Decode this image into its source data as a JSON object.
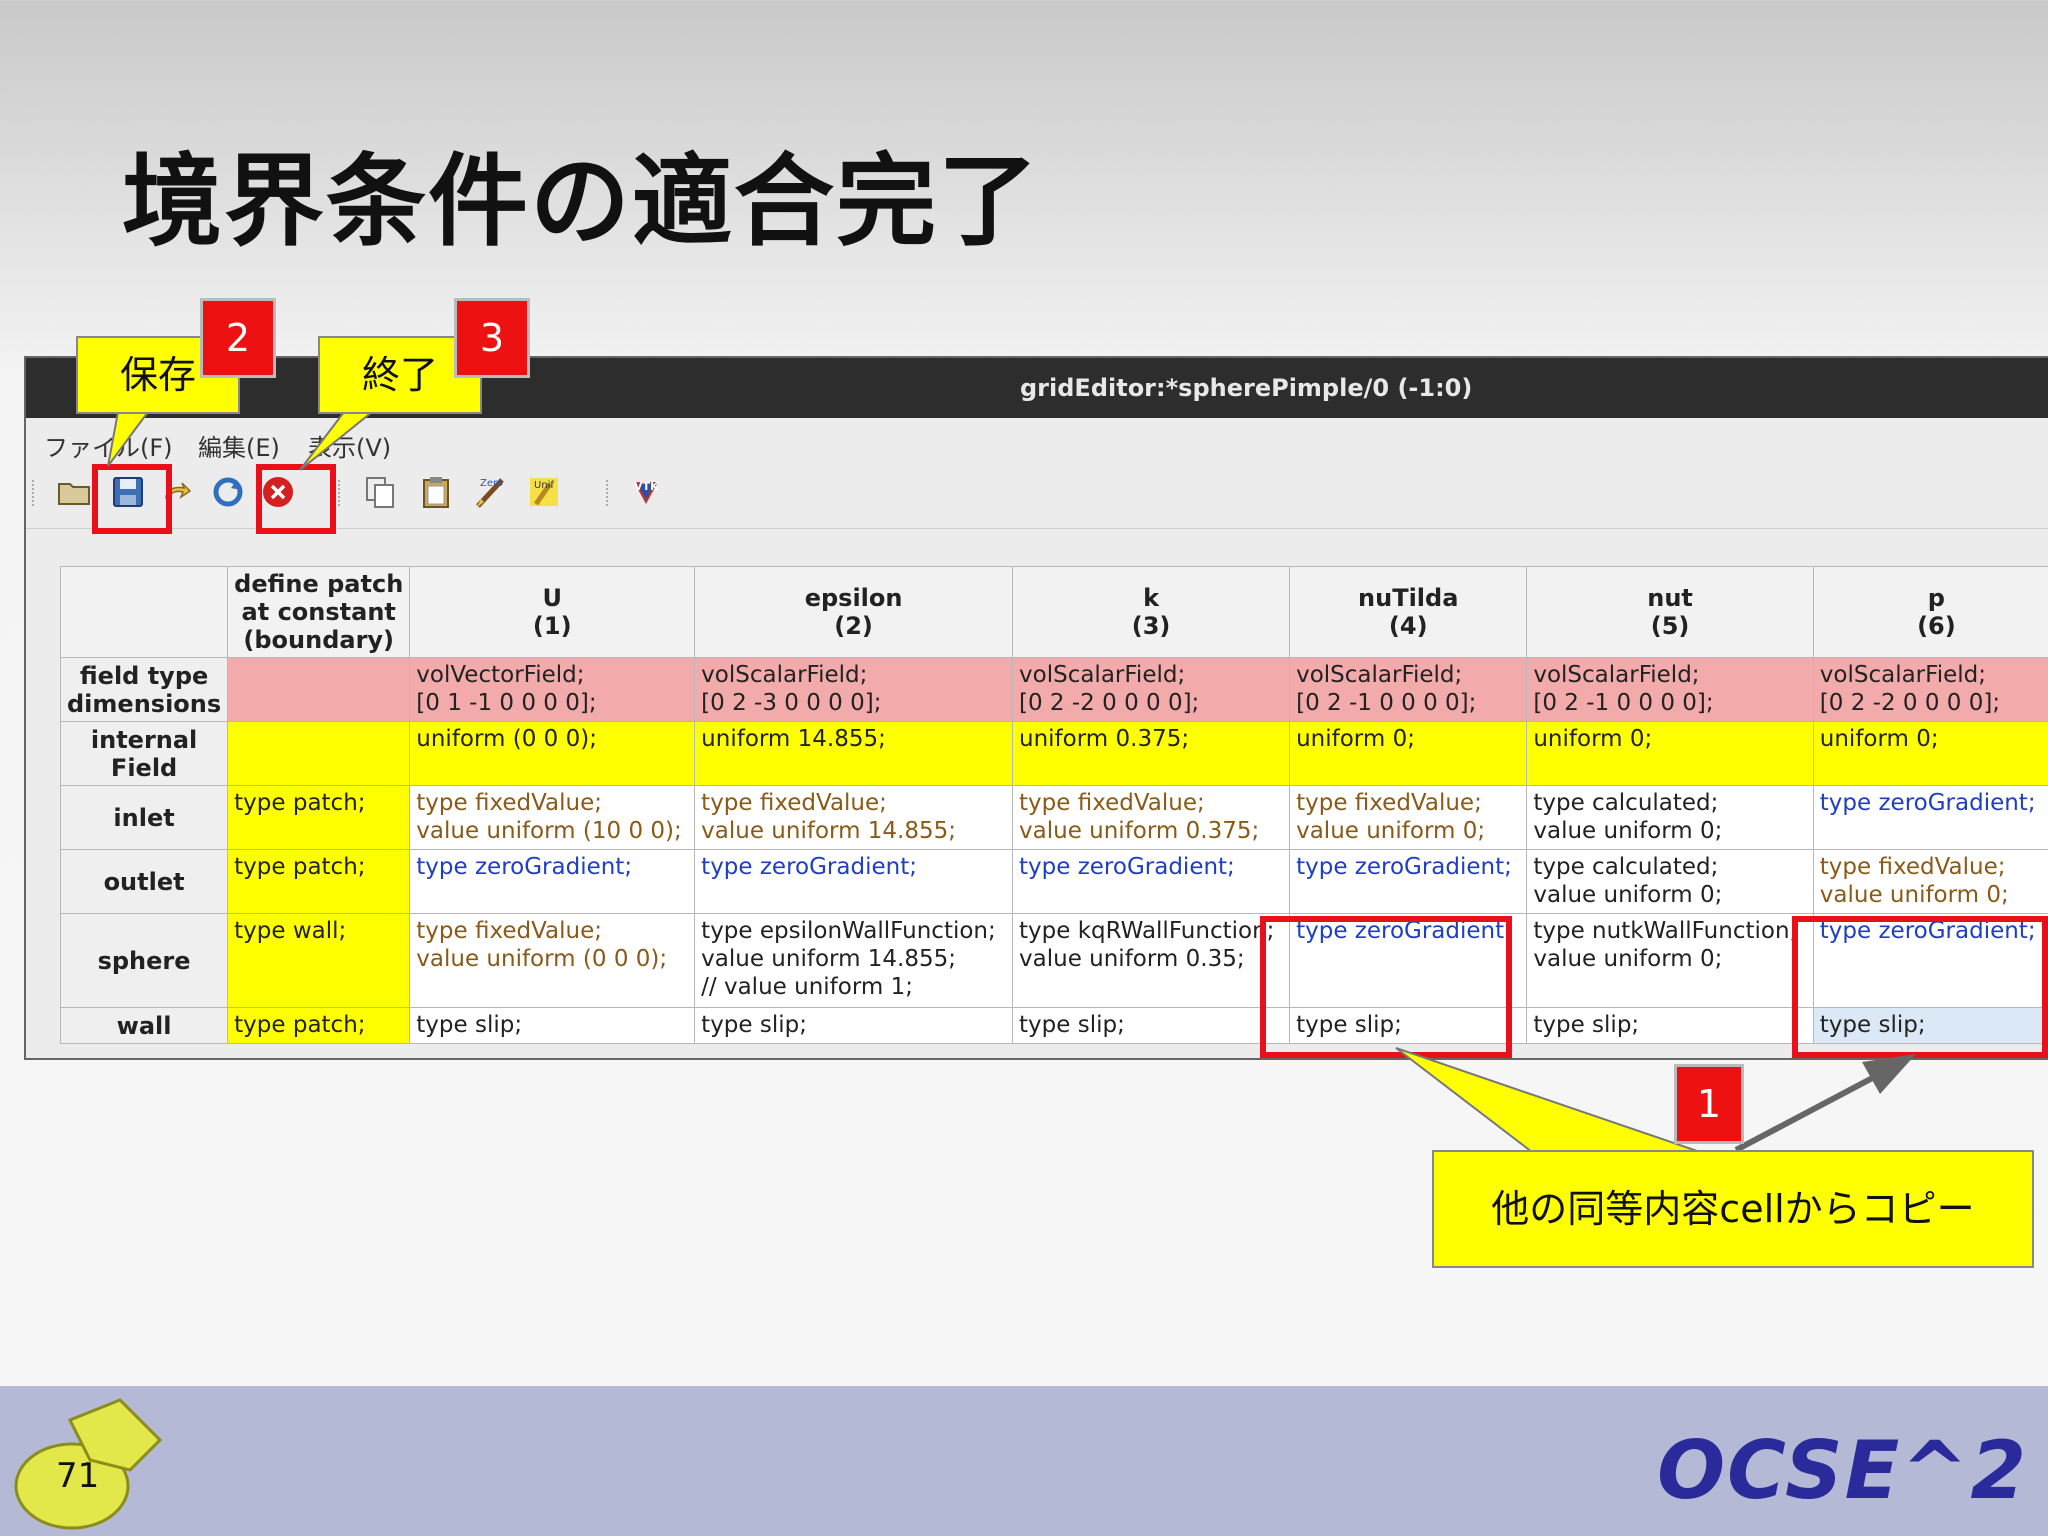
{
  "slide": {
    "title": "境界条件の適合完了",
    "page_number": "71",
    "brand": "OCSE^2"
  },
  "window": {
    "title": "gridEditor:*spherePimple/0 (-1:0)",
    "menu": [
      "ファイル(F)",
      "編集(E)",
      "表示(V)"
    ],
    "toolbar": [
      "open-folder-icon",
      "save-icon",
      "redo-icon",
      "refresh-icon",
      "close-icon",
      "copy-icon",
      "paste-icon",
      "zero-icon",
      "unif-icon",
      "vtk-icon"
    ]
  },
  "grid": {
    "columns": [
      {
        "name": "define patch\nat constant\n(boundary)"
      },
      {
        "name": "U",
        "index": "(1)"
      },
      {
        "name": "epsilon",
        "index": "(2)"
      },
      {
        "name": "k",
        "index": "(3)"
      },
      {
        "name": "nuTilda",
        "index": "(4)"
      },
      {
        "name": "nut",
        "index": "(5)"
      },
      {
        "name": "p",
        "index": "(6)"
      }
    ],
    "header_define": [
      "define patch",
      "at constant",
      "(boundary)"
    ],
    "rows": [
      {
        "label": [
          "field type",
          "dimensions"
        ],
        "patch": "",
        "cells": [
          [
            "volVectorField;",
            "[0 1 -1 0 0 0 0];"
          ],
          [
            "volScalarField;",
            "[0 2 -3 0 0 0 0];"
          ],
          [
            "volScalarField;",
            "[0 2 -2 0 0 0 0];"
          ],
          [
            "volScalarField;",
            "[0 2 -1 0 0 0 0];"
          ],
          [
            "volScalarField;",
            "[0 2 -1 0 0 0 0];"
          ],
          [
            "volScalarField;",
            "[0 2 -2 0 0 0 0];"
          ]
        ]
      },
      {
        "label": [
          "internal",
          "Field"
        ],
        "patch": "",
        "cells": [
          [
            "uniform (0 0 0);"
          ],
          [
            "uniform 14.855;"
          ],
          [
            "uniform 0.375;"
          ],
          [
            "uniform 0;"
          ],
          [
            "uniform 0;"
          ],
          [
            "uniform 0;"
          ]
        ]
      },
      {
        "label": [
          "inlet"
        ],
        "patch": "type patch;",
        "cells": [
          [
            "type fixedValue;",
            "value uniform (10 0 0);"
          ],
          [
            "type fixedValue;",
            "value uniform 14.855;"
          ],
          [
            "type fixedValue;",
            "value uniform 0.375;"
          ],
          [
            "type fixedValue;",
            "value uniform 0;"
          ],
          [
            "type calculated;",
            "value uniform 0;"
          ],
          [
            "type zeroGradient;"
          ]
        ]
      },
      {
        "label": [
          "outlet"
        ],
        "patch": "type patch;",
        "cells": [
          [
            "type zeroGradient;"
          ],
          [
            "type zeroGradient;"
          ],
          [
            "type zeroGradient;"
          ],
          [
            "type zeroGradient;"
          ],
          [
            "type calculated;",
            "value uniform 0;"
          ],
          [
            "type fixedValue;",
            "value uniform 0;"
          ]
        ]
      },
      {
        "label": [
          "sphere"
        ],
        "patch": "type wall;",
        "cells": [
          [
            "type fixedValue;",
            "value uniform (0 0 0);"
          ],
          [
            "type epsilonWallFunction;",
            "value uniform 14.855;",
            "// value uniform 1;"
          ],
          [
            "type kqRWallFunction;",
            "value uniform 0.35;"
          ],
          [
            "type zeroGradient;"
          ],
          [
            "type nutkWallFunction;",
            "value uniform 0;"
          ],
          [
            "type zeroGradient;"
          ]
        ]
      },
      {
        "label": [
          "wall"
        ],
        "patch": "type patch;",
        "cells": [
          [
            "type slip;"
          ],
          [
            "type slip;"
          ],
          [
            "type slip;"
          ],
          [
            "type slip;"
          ],
          [
            "type slip;"
          ],
          [
            "type slip;"
          ]
        ]
      }
    ]
  },
  "annotations": {
    "save_callout": "保存",
    "exit_callout": "終了",
    "badge_1": "1",
    "badge_2": "2",
    "badge_3": "3",
    "copy_callout": "他の同等内容cellからコピー"
  },
  "colors": {
    "field_type_row": "#f2aaaa",
    "internal_field_row": "#ffff00",
    "fixed_value_text": "#8a5a17",
    "zero_gradient_text": "#1f3ec2",
    "highlight": "#e8101a",
    "callout": "#ffff00",
    "badge": "#ee1111",
    "titlebar": "#2d2d2d",
    "footer": "#b4b9d6"
  }
}
